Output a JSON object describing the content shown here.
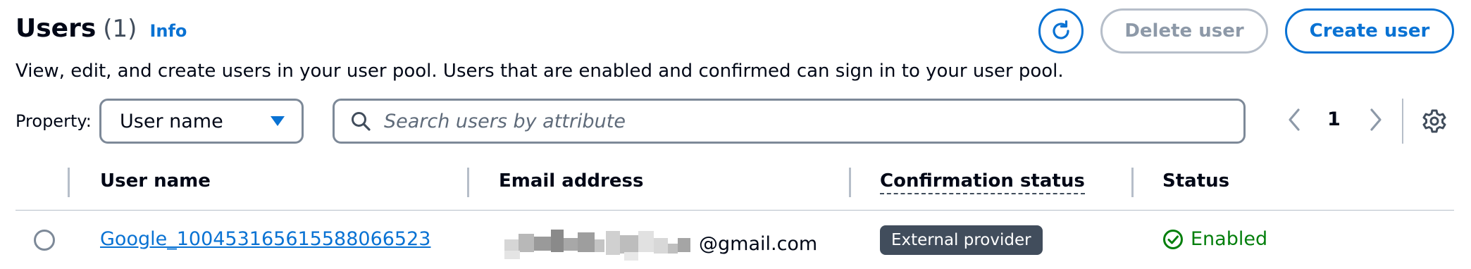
{
  "header": {
    "title": "Users",
    "count": "(1)",
    "info_label": "Info",
    "description": "View, edit, and create users in your user pool. Users that are enabled and confirmed can sign in to your user pool.",
    "delete_label": "Delete user",
    "create_label": "Create user"
  },
  "filter": {
    "property_label": "Property:",
    "property_value": "User name",
    "search_placeholder": "Search users by attribute"
  },
  "pagination": {
    "current_page": "1"
  },
  "table": {
    "columns": [
      "User name",
      "Email address",
      "Confirmation status",
      "Status"
    ],
    "rows": [
      {
        "user_name": "Google_100453165615588066523",
        "email_suffix": "@gmail.com",
        "confirmation_status": "External provider",
        "status": "Enabled"
      }
    ]
  },
  "colors": {
    "accent": "#0972d3",
    "success": "#037f0c",
    "badge_bg": "#414d5c",
    "disabled": "#8d99a8"
  },
  "icons": {
    "refresh": "refresh-icon",
    "dropdown": "caret-down-icon",
    "search": "search-icon",
    "prev": "chevron-left-icon",
    "next": "chevron-right-icon",
    "settings": "gear-icon",
    "status_ok": "check-circle-icon"
  }
}
